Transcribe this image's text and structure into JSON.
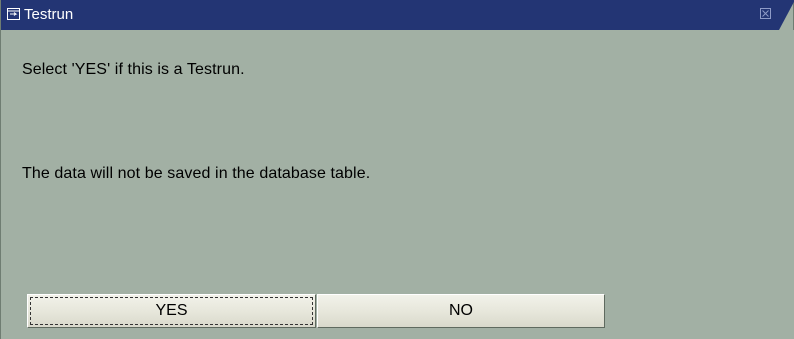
{
  "window": {
    "title": "Testrun",
    "icons": {
      "title": "dialog-window-icon",
      "close": "close-icon"
    },
    "colors": {
      "titlebar": "#233574",
      "background": "#a2b0a4"
    }
  },
  "message": {
    "line1": "Select 'YES' if this is a Testrun.",
    "line2": "The data will not be saved in the database table."
  },
  "buttons": {
    "yes_label": "YES",
    "no_label": "NO"
  }
}
